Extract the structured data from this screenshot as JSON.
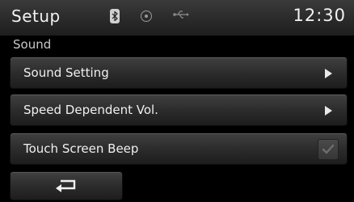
{
  "header": {
    "title": "Setup",
    "clock": "12:30",
    "icons": [
      "bluetooth-icon",
      "disc-icon",
      "usb-icon"
    ]
  },
  "subtitle": "Sound",
  "menu": {
    "items": [
      {
        "label": "Sound Setting",
        "control": "arrow"
      },
      {
        "label": "Speed Dependent Vol.",
        "control": "arrow"
      },
      {
        "label": "Touch Screen Beep",
        "control": "checkbox",
        "checked": true
      }
    ]
  },
  "footer": {
    "back_icon": "return-arrow-icon"
  },
  "colors": {
    "background": "#000000",
    "button": "#2c2c2c",
    "text": "#f0f0f0"
  }
}
